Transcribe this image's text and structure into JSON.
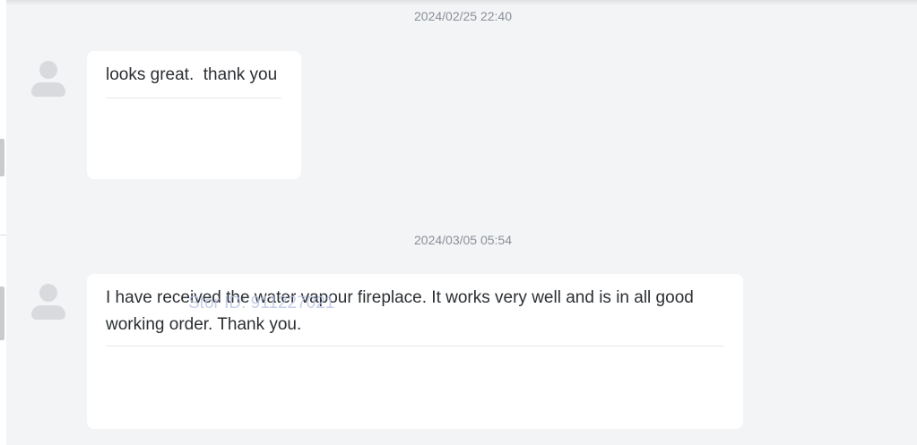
{
  "conversation": {
    "messages": [
      {
        "timestamp": "2024/02/25 22:40",
        "text": "looks great.  thank you"
      },
      {
        "timestamp": "2024/03/05 05:54",
        "text": "I have received the water vapour fireplace. It works very well and is in all good working order. Thank you."
      }
    ]
  },
  "watermark": "Stor ID: 911227021",
  "icons": {
    "avatar": "user-avatar-icon"
  }
}
